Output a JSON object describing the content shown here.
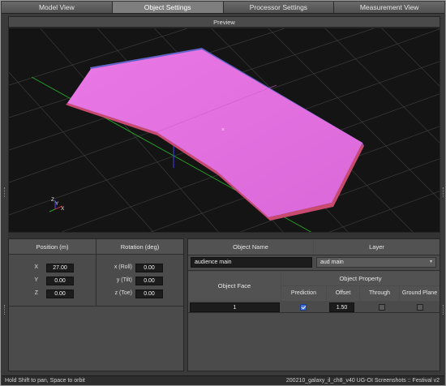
{
  "tabs": [
    "Model View",
    "Object Settings",
    "Processor Settings",
    "Measurement View"
  ],
  "active_tab": "Object Settings",
  "preview": {
    "title": "Preview",
    "axis_labels": {
      "z": "Z",
      "y": "Y",
      "x": "X"
    },
    "colors": {
      "top": "#e36fe0",
      "side_blue": "#6163c9",
      "side_red": "#c94a6e",
      "grid": "#3c3c3c"
    }
  },
  "position": {
    "header": "Position (m)",
    "x_label": "X",
    "x_value": "27.00",
    "y_label": "Y",
    "y_value": "0.00",
    "z_label": "Z",
    "z_value": "0.00"
  },
  "rotation": {
    "header": "Rotation (deg)",
    "roll_label": "x (Roll)",
    "roll_value": "0.00",
    "tilt_label": "y (Tilt)",
    "tilt_value": "0.00",
    "toe_label": "z (Toe)",
    "toe_value": "0.00"
  },
  "object": {
    "name_header": "Object Name",
    "name_value": "audience main",
    "layer_header": "Layer",
    "layer_value": "aud main",
    "face_header": "Object Face",
    "property_header": "Object Property",
    "prediction_header": "Prediction",
    "offset_header": "Offset",
    "through_header": "Through",
    "ground_header": "Ground Plane",
    "row": {
      "face": "1",
      "prediction": true,
      "offset": "1.50",
      "through": false,
      "ground_plane": false
    }
  },
  "status": {
    "hint": "Hold Shift to pan, Space to orbit",
    "file": "200210_galaxy_il_ch8_v40 UG-OI Screenshots :: Festival v2"
  }
}
